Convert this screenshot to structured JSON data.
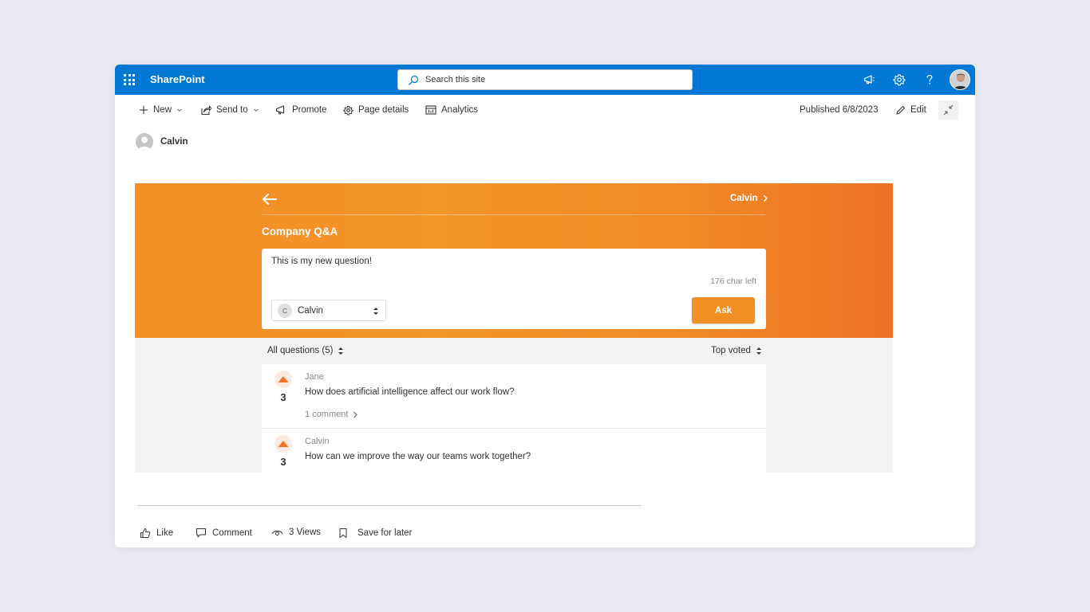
{
  "suitebar": {
    "app_name": "SharePoint",
    "search_placeholder": "Search this site"
  },
  "commandbar": {
    "new_label": "New",
    "send_to_label": "Send to",
    "promote_label": "Promote",
    "page_details_label": "Page details",
    "analytics_label": "Analytics",
    "published_label": "Published 6/8/2023",
    "edit_label": "Edit"
  },
  "author": {
    "name": "Calvin"
  },
  "qa": {
    "crumb_label": "Calvin",
    "title": "Company Q&A",
    "ask": {
      "question_text": "This is my new question!",
      "char_left": "176 char left",
      "user_initial": "C",
      "user_name": "Calvin",
      "ask_label": "Ask"
    },
    "filter_label": "All questions (5)",
    "sort_label": "Top voted",
    "questions": [
      {
        "author": "Jane",
        "votes": "3",
        "text": "How does artificial intelligence affect our work flow?",
        "comments": "1 comment"
      },
      {
        "author": "Calvin",
        "votes": "3",
        "text": "How can we improve the way our teams work together?"
      }
    ]
  },
  "footer": {
    "like_label": "Like",
    "comment_label": "Comment",
    "views_label": "3 Views",
    "save_label": "Save for later"
  },
  "colors": {
    "suitebar": "#0078d4",
    "accent_orange": "#f28f24",
    "background": "#e9e9f3"
  }
}
